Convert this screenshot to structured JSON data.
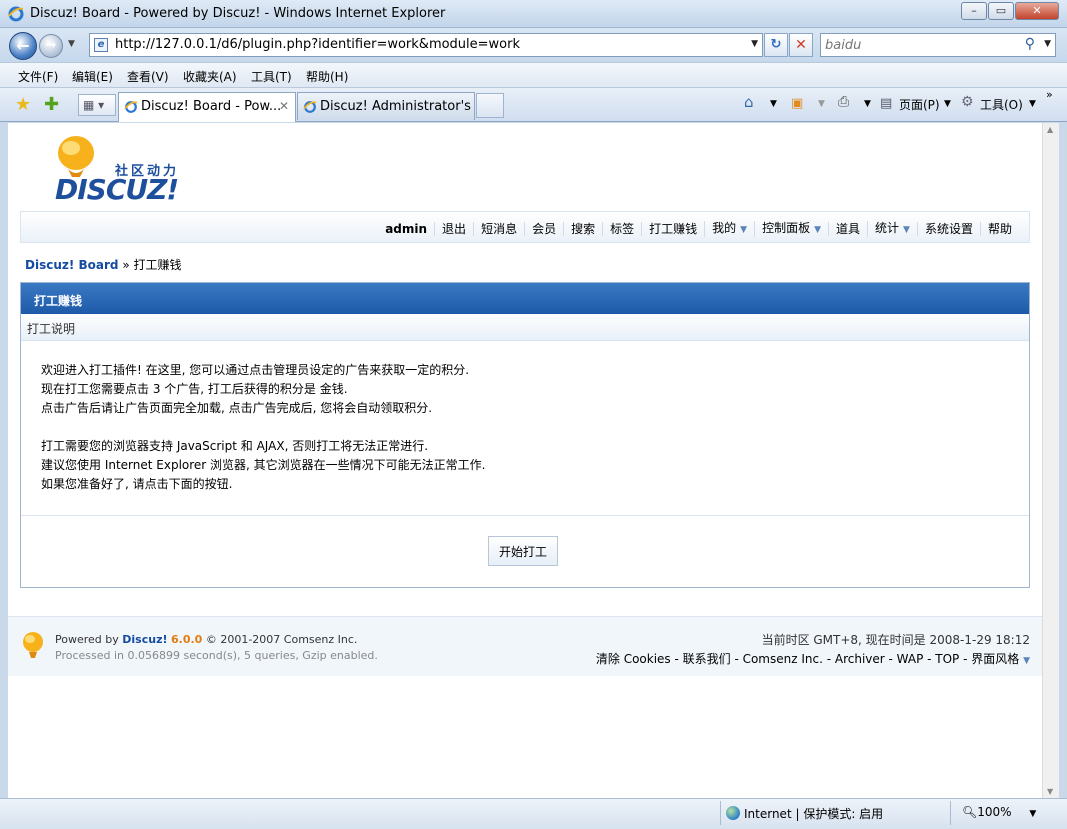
{
  "window": {
    "title": "Discuz! Board - Powered by Discuz! - Windows Internet Explorer"
  },
  "address_bar": {
    "url": "http://127.0.0.1/d6/plugin.php?identifier=work&module=work"
  },
  "search": {
    "placeholder": "baidu"
  },
  "menu": [
    "文件(F)",
    "编辑(E)",
    "查看(V)",
    "收藏夹(A)",
    "工具(T)",
    "帮助(H)"
  ],
  "tabs": [
    {
      "label": "Discuz! Board - Pow...",
      "active": true
    },
    {
      "label": "Discuz! Administrator's ...",
      "active": false
    }
  ],
  "commands": {
    "page": "页面(P)",
    "tools": "工具(O)"
  },
  "site": {
    "logo_cn": "社区动力",
    "logo_en": "DISCUZ!",
    "nav": {
      "username": "admin",
      "items": [
        "退出",
        "短消息",
        "会员",
        "搜索",
        "标签",
        "打工赚钱",
        "我的",
        "控制面板",
        "道具",
        "统计",
        "系统设置",
        "帮助"
      ]
    },
    "breadcrumb": {
      "home": "Discuz! Board",
      "sep": " » ",
      "current": "打工赚钱"
    },
    "panel": {
      "title": "打工赚钱",
      "subtitle": "打工说明",
      "lines": [
        "欢迎进入打工插件! 在这里, 您可以通过点击管理员设定的广告来获取一定的积分.",
        "现在打工您需要点击  3 个广告, 打工后获得的积分是  金钱.",
        "点击广告后请让广告页面完全加载, 点击广告完成后, 您将会自动领取积分.",
        "打工需要您的浏览器支持  JavaScript 和  AJAX, 否则打工将无法正常进行.",
        "建议您使用  Internet Explorer 浏览器, 其它浏览器在一些情况下可能无法正常工作.",
        "如果您准备好了, 请点击下面的按钮."
      ],
      "button": "开始打工"
    },
    "footer": {
      "powered_prefix": "Powered by ",
      "brand": "Discuz!",
      "version": "6.0.0",
      "copyright": "© 2001-2007 Comsenz Inc.",
      "processed": "Processed in 0.056899 second(s), 5 queries, Gzip enabled.",
      "timezone": "当前时区  GMT+8, 现在时间是  2008-1-29 18:12",
      "links": "清除  Cookies - 联系我们  - Comsenz Inc. - Archiver - WAP - TOP - 界面风格"
    }
  },
  "status": {
    "zone": "Internet | 保护模式: 启用",
    "zoom": "100%"
  },
  "colors": {
    "accent": "#1d5aa8",
    "link": "#154ba0",
    "version": "#e27c12"
  }
}
